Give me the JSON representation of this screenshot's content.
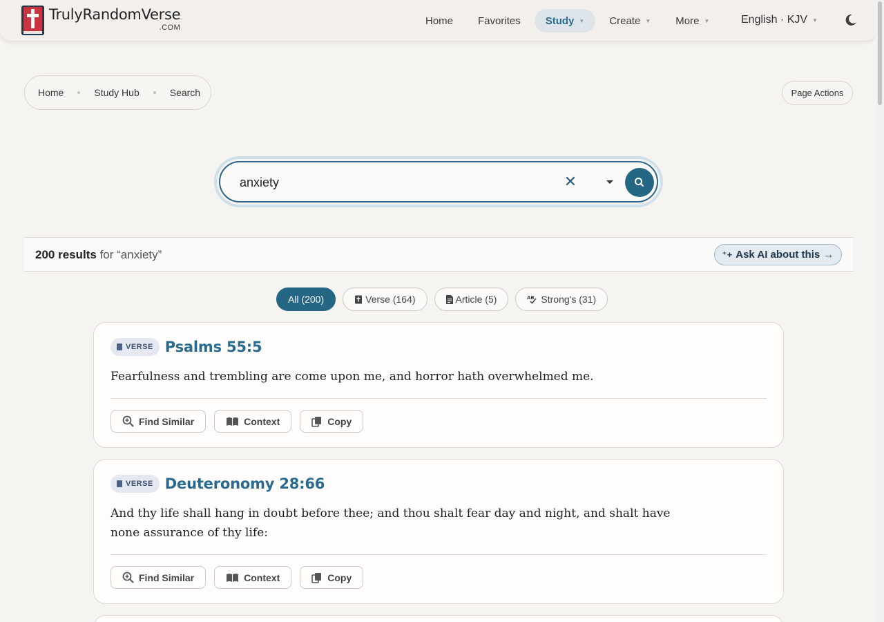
{
  "header": {
    "logo": {
      "name": "TrulyRandomVerse",
      "suffix": ".COM"
    },
    "nav": [
      {
        "label": "Home"
      },
      {
        "label": "Favorites"
      },
      {
        "label": "Study"
      },
      {
        "label": "Create"
      },
      {
        "label": "More"
      }
    ],
    "language": "English · KJV"
  },
  "breadcrumb": [
    "Home",
    "Study Hub",
    "Search"
  ],
  "page_actions": "Page Actions",
  "search": {
    "value": "anxiety"
  },
  "results": {
    "count": "200 results",
    "query_text": " for “anxiety”",
    "ask_ai": "Ask AI about this"
  },
  "filters": [
    {
      "label": "All (200)"
    },
    {
      "label": "Verse (164)"
    },
    {
      "label": "Article (5)"
    },
    {
      "label": "Strong's (31)"
    }
  ],
  "cards": [
    {
      "tag": "VERSE",
      "title": "Psalms 55:5",
      "text": "Fearfulness and trembling are come upon me, and horror hath overwhelmed me.",
      "actions": [
        "Find Similar",
        "Context",
        "Copy"
      ]
    },
    {
      "tag": "VERSE",
      "title": "Deuteronomy 28:66",
      "text": "And thy life shall hang in doubt before thee; and thou shalt fear day and night, and shalt have none assurance of thy life:",
      "actions": [
        "Find Similar",
        "Context",
        "Copy"
      ]
    }
  ],
  "colors": {
    "accent": "#266685",
    "title": "#2a6a8f",
    "background": "#f6f4f1"
  }
}
